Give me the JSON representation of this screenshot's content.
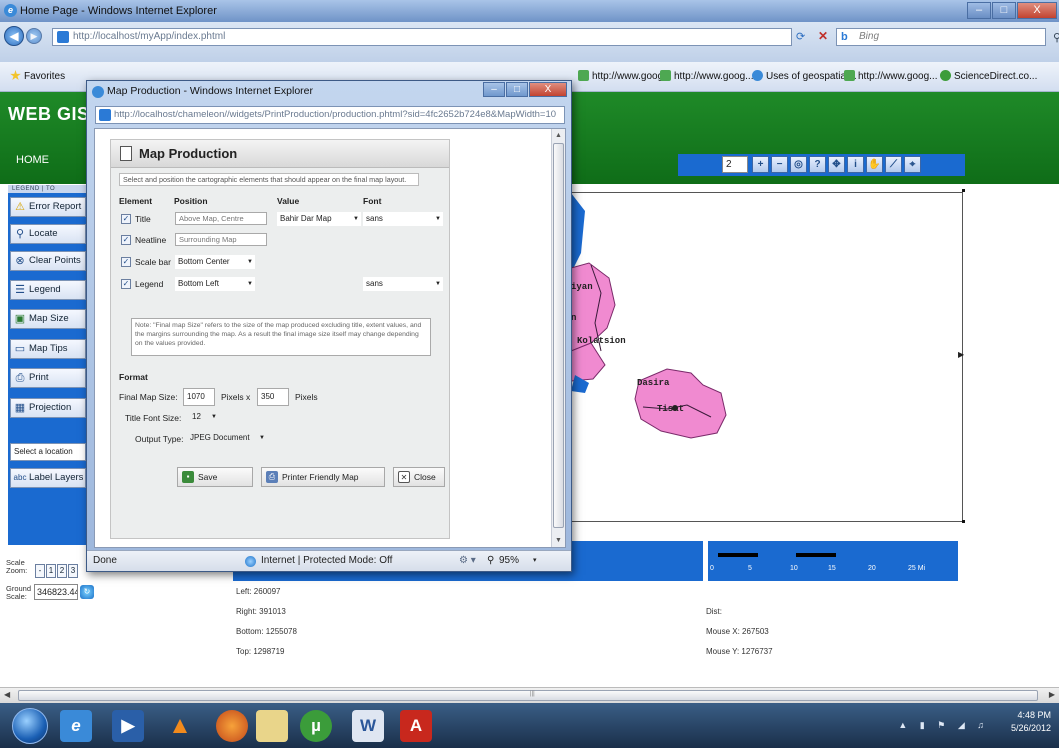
{
  "browser": {
    "window_title": "Home Page - Windows Internet Explorer",
    "address": "http://localhost/myApp/index.phtml",
    "address_host": "localhost",
    "search_placeholder": "Bing",
    "window_controls": [
      "–",
      "□",
      "X"
    ],
    "favorites": [
      "Favorites",
      "http://www.goog...",
      "http://www.goog...",
      "Uses of geospatial...",
      "http://www.goog...",
      "ScienceDirect.co..."
    ]
  },
  "gis": {
    "title": "WEB GIS F",
    "home": "HOME",
    "zoom_value": "2",
    "tools": [
      "zoom-in-icon",
      "zoom-out-icon",
      "zoom-full-icon",
      "query-icon",
      "pan-icon",
      "identify-icon",
      "hand-icon",
      "measure-icon",
      "select-icon"
    ],
    "left_tabs": "LEGEND | TO",
    "left_buttons": [
      {
        "label": "Error Report",
        "icon": "warning-icon"
      },
      {
        "label": "Locate",
        "icon": "binoculars-icon"
      },
      {
        "label": "Clear Points",
        "icon": "clear-icon"
      },
      {
        "label": "Legend",
        "icon": "legend-icon"
      },
      {
        "label": "Map Size",
        "icon": "map-size-icon"
      },
      {
        "label": "Map Tips",
        "icon": "tips-icon"
      },
      {
        "label": "Print",
        "icon": "print-icon"
      },
      {
        "label": "Projection",
        "icon": "projection-icon"
      }
    ],
    "select_location": "Select a location",
    "label_layers": "Label Layers",
    "map_labels": [
      "iyan",
      "n",
      "Kolatsion",
      "Dasira",
      "Tisat"
    ],
    "scale_zoom_label": "Scale Zoom:",
    "zoom_steps": [
      "-",
      "1",
      "2",
      "3"
    ],
    "ground_scale_label": "Ground Scale:",
    "ground_scale_value": "346823.445",
    "extents": {
      "left": "Left: 260097",
      "right": "Right: 391013",
      "bottom": "Bottom: 1255078",
      "top": "Top: 1298719"
    },
    "dist": "Dist:",
    "mouse_x": "Mouse X: 267503",
    "mouse_y": "Mouse Y: 1276737",
    "scalebar_labels": [
      "0",
      "5",
      "10",
      "15",
      "20",
      "25 Mi"
    ]
  },
  "popup": {
    "window_title": "Map Production - Windows Internet Explorer",
    "address": "http://localhost/chameleon//widgets/PrintProduction/production.phtml?sid=4fc2652b724e8&MapWidth=10",
    "address_host": "localhost",
    "status_done": "Done",
    "status_zone": "Internet | Protected Mode: Off",
    "zoom": "95%"
  },
  "map_production": {
    "title": "Map Production",
    "description": "Select and position the cartographic elements that should appear on the final map layout.",
    "columns": {
      "element": "Element",
      "position": "Position",
      "value": "Value",
      "font": "Font"
    },
    "rows": [
      {
        "checked": true,
        "element": "Title",
        "position": "Above Map, Centre",
        "value": "Bahir Dar Map",
        "font": "sans"
      },
      {
        "checked": true,
        "element": "Neatline",
        "position": "Surrounding Map",
        "value": "",
        "font": ""
      },
      {
        "checked": true,
        "element": "Scale bar",
        "position": "Bottom Center",
        "value": "",
        "font": ""
      },
      {
        "checked": true,
        "element": "Legend",
        "position": "Bottom Left",
        "value": "",
        "font": "sans"
      }
    ],
    "note": "Note: \"Final map Size\" refers to the size of the map produced excluding title, extent values, and the margins surrounding the map. As a result the final image size itself may change depending on the values provided.",
    "format_label": "Format",
    "final_map_size_label": "Final Map Size:",
    "width": "1070",
    "pixels_x": "Pixels x",
    "height": "350",
    "pixels": "Pixels",
    "title_font_size_label": "Title Font Size:",
    "title_font_size": "12",
    "output_type_label": "Output Type:",
    "output_type": "JPEG Document",
    "buttons": {
      "save": "Save",
      "printer": "Printer Friendly Map",
      "close": "Close"
    }
  },
  "taskbar": {
    "time": "4:48 PM",
    "date": "5/26/2012",
    "apps": [
      "ie-icon",
      "media-player-icon",
      "vlc-icon",
      "firefox-icon",
      "folder-icon",
      "utorrent-icon",
      "word-icon",
      "acrobat-icon"
    ]
  },
  "colors": {
    "gis_green": "#1f8a28",
    "panel_blue": "#1a6ad0",
    "district_pink": "#f08ad0"
  }
}
